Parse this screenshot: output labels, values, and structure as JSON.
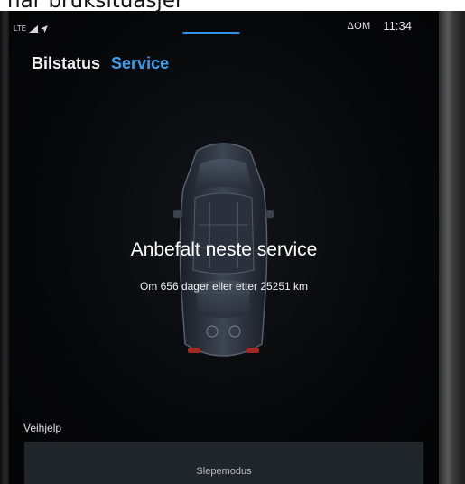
{
  "caption": {
    "partial_text": "nar bruksituasjer"
  },
  "status_bar": {
    "network_label": "LTE",
    "audio_label": "ΔOM",
    "time": "11:34",
    "accent_color": "#2f8fe0"
  },
  "tabs": [
    {
      "label": "Bilstatus",
      "active": false
    },
    {
      "label": "Service",
      "active": true
    }
  ],
  "service": {
    "title": "Anbefalt neste service",
    "detail": "Om 656 dager eller etter 25251 km"
  },
  "assistance": {
    "section_label": "Veihjelp",
    "tow_mode_button": "Slepemodus"
  },
  "icons": [
    "signal-icon",
    "location-arrow-icon",
    "car-icon"
  ],
  "colors": {
    "active_tab": "#3a9ff0",
    "background": "#07080a",
    "button": "#20252a"
  }
}
